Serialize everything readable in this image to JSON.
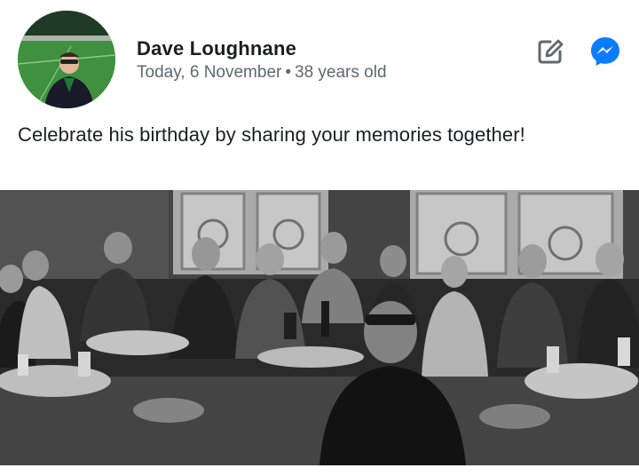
{
  "post": {
    "author_name": "Dave Loughnane",
    "date": "Today, 6 November",
    "separator": "•",
    "age": "38 years old",
    "message": "Celebrate his birthday by sharing your memories together!"
  },
  "actions": {
    "edit_icon": "edit-icon",
    "messenger_icon": "messenger-icon"
  },
  "colors": {
    "messenger_blue": "#0a7cff",
    "name_text": "#1c1e21",
    "meta_text": "#606770"
  }
}
